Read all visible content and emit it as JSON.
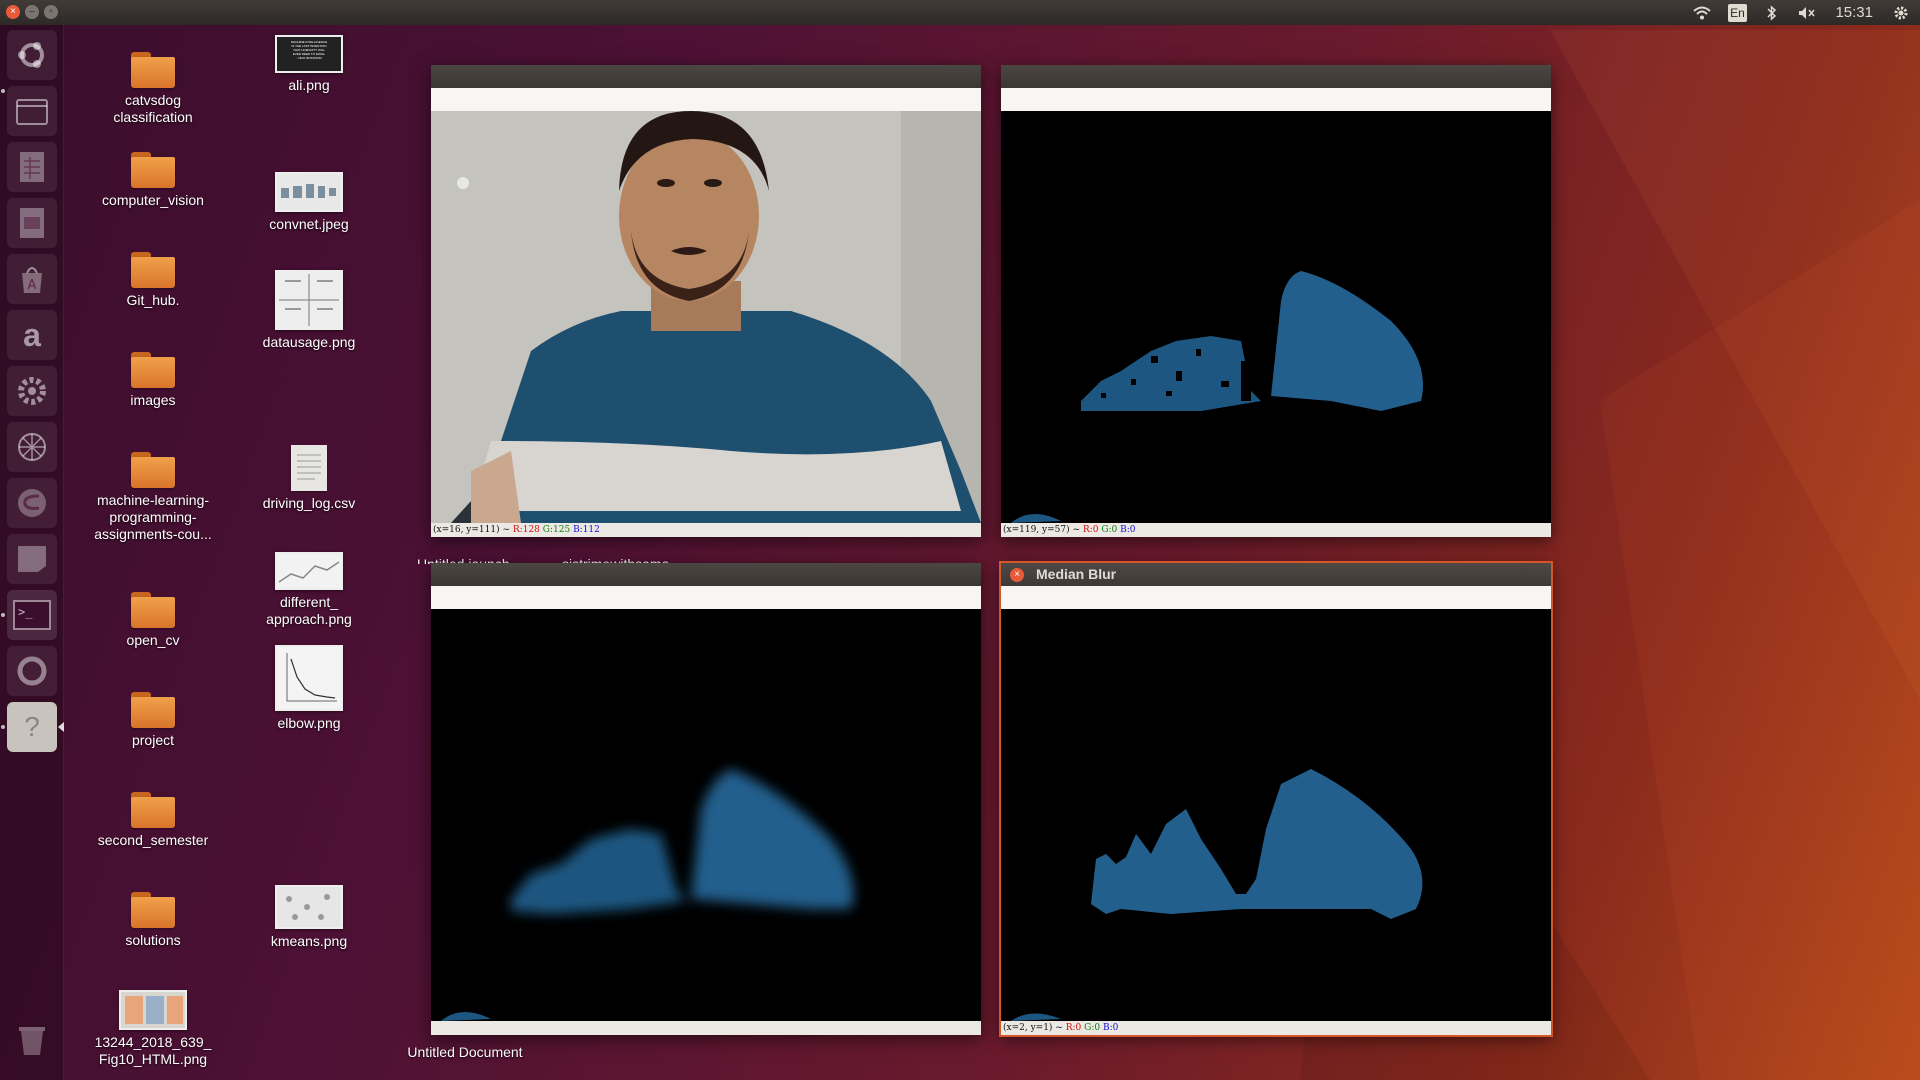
{
  "topbar": {
    "tray_icons": [
      "wifi-icon",
      "keyboard-layout-icon",
      "bluetooth-icon",
      "volume-muted-icon"
    ],
    "keyboard_layout": "En",
    "time": "15:31"
  },
  "launcher": {
    "items": [
      "ubuntu-dash-icon",
      "files-icon",
      "spreadsheet-icon",
      "presentation-icon",
      "software-center-icon",
      "amazon-icon",
      "settings-icon",
      "network-icon",
      "emacs-icon",
      "notes-icon",
      "terminal-icon",
      "update-icon",
      "help-icon"
    ],
    "amazon_glyph": "a",
    "help_glyph": "?",
    "terminal_glyph": ">_"
  },
  "desktop": {
    "col1": [
      {
        "label": "catvsdog\nclassification"
      },
      {
        "label": "computer_vision"
      },
      {
        "label": "Git_hub."
      },
      {
        "label": "images"
      },
      {
        "label": "machine-learning-\nprogramming-\nassignments-cou..."
      },
      {
        "label": "open_cv"
      },
      {
        "label": "project"
      },
      {
        "label": "second_semester"
      },
      {
        "label": "solutions"
      },
      {
        "label": "13244_2018_639_\nFig10_HTML.png"
      }
    ],
    "col2": [
      {
        "label": "ali.png"
      },
      {
        "label": "convnet.jpeg"
      },
      {
        "label": "datausage.png"
      },
      {
        "label": "driving_log.csv"
      },
      {
        "label": "different_\napproach.png"
      },
      {
        "label": "elbow.png"
      },
      {
        "label": "kmeans.png"
      }
    ],
    "untitled_document": "Untitled Document",
    "partial_label_1": "Untitled jaunch",
    "partial_label_2": "sistrimewithsama",
    "ali_thumb_text": "MACHINE INTELLIGENCE\nIS THE LAST INVENTION\nTHAT HUMANITY WILL\nEVER NEED TO MAKE.\n- NICK BOSTROM"
  },
  "windows": {
    "top_left": {
      "title": "",
      "status": {
        "coords": "(x=16, y=111) ~",
        "r": "R:128",
        "g": "G:125",
        "b": "B:112"
      }
    },
    "top_right": {
      "title": "",
      "status": {
        "coords": "(x=119, y=57) ~",
        "r": "R:0",
        "g": "G:0",
        "b": "B:0"
      }
    },
    "bottom_left": {
      "title": "",
      "status": {
        "coords": "",
        "r": "",
        "g": "",
        "b": ""
      }
    },
    "bottom_right": {
      "title": "Median Blur",
      "status": {
        "coords": "(x=2, y=1) ~",
        "r": "R:0",
        "g": "G:0",
        "b": "B:0"
      }
    }
  },
  "colors": {
    "accent": "#d4572a",
    "blue_mask": "#1f5c8a",
    "sweater_blue": "#1e4f6e"
  }
}
